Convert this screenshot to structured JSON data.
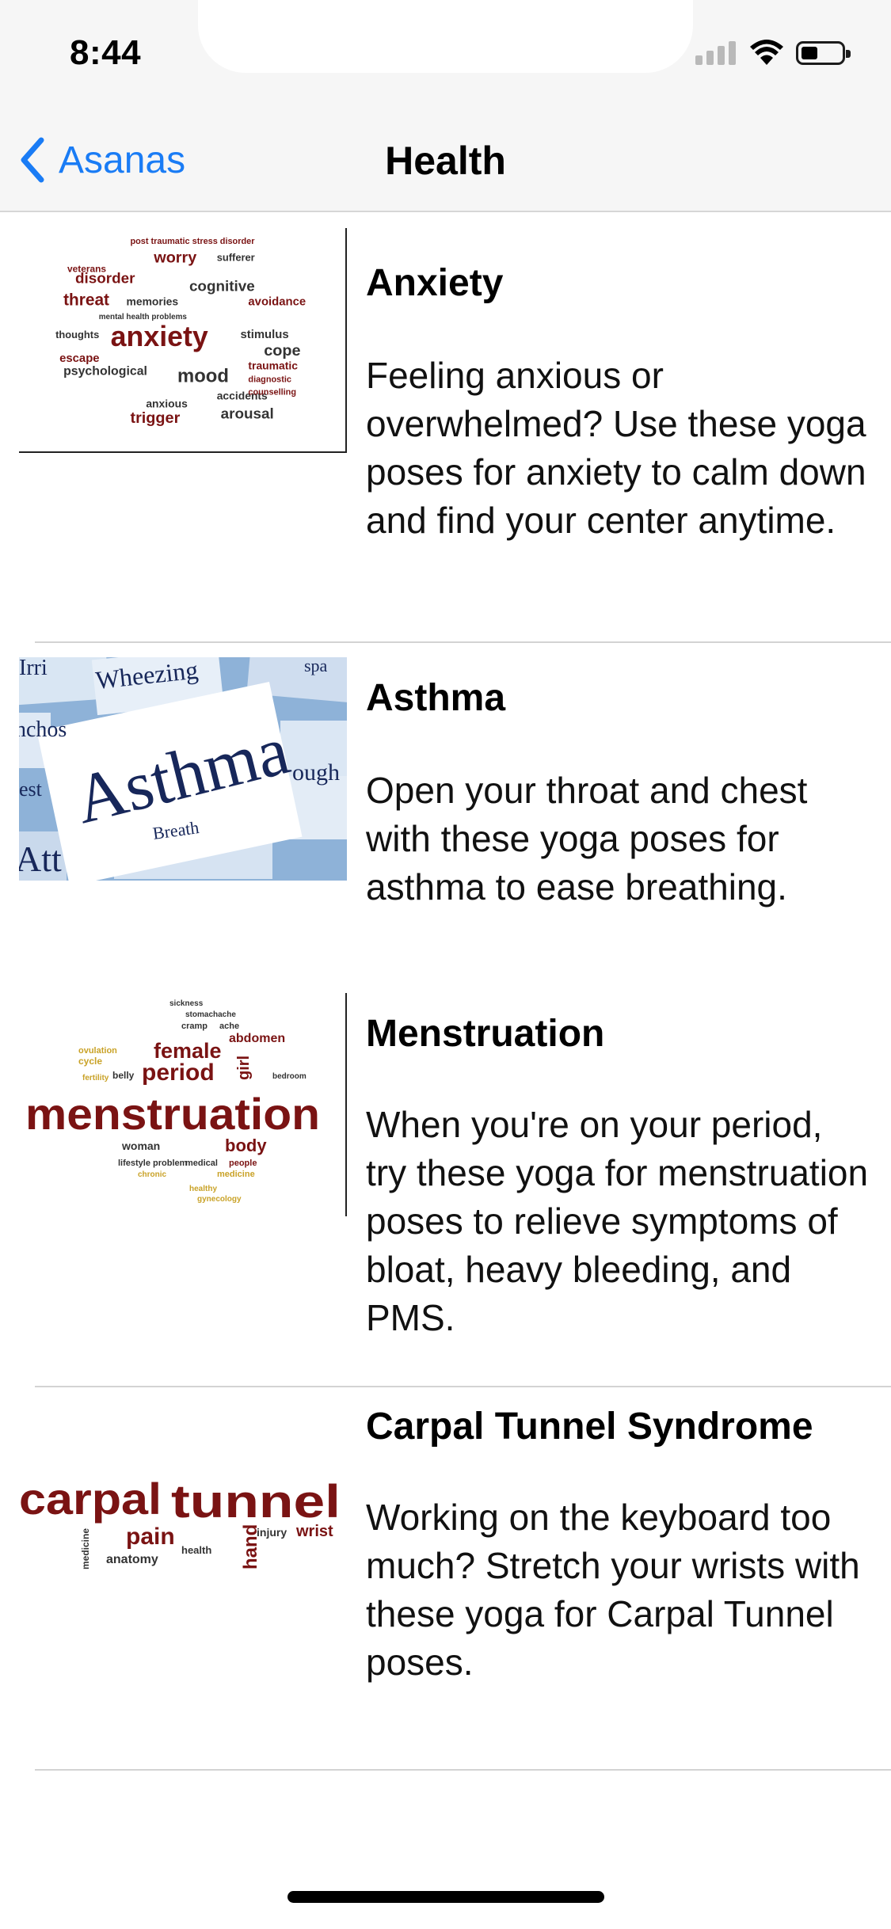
{
  "status_bar": {
    "time": "8:44"
  },
  "nav": {
    "back_label": "Asanas",
    "title": "Health"
  },
  "items": [
    {
      "title": "Anxiety",
      "description": "Feeling anxious or overwhelmed? Use these yoga poses for anxiety to calm down and find your center anytime.",
      "thumbnail": {
        "main_word": "anxiety",
        "words": [
          "post traumatic stress disorder",
          "worry",
          "sufferer",
          "disorder",
          "cognitive",
          "threat",
          "memories",
          "avoidance",
          "stimulus",
          "cope",
          "escape",
          "psychological",
          "mood",
          "traumatic",
          "diagnostic",
          "accidents",
          "counselling",
          "anxious",
          "trigger",
          "arousal",
          "thoughts",
          "veterans",
          "mental health problems"
        ]
      }
    },
    {
      "title": "Asthma",
      "description": "Open your throat and chest with these yoga poses for asthma to ease breathing.",
      "thumbnail": {
        "main_word": "Asthma",
        "words": [
          "Wheezing",
          "Irri",
          "nchos",
          "Breath",
          "ough",
          "spa",
          "est",
          "Att"
        ]
      }
    },
    {
      "title": "Menstruation",
      "description": "When you're on your period, try these yoga for menstruation poses to relieve symptoms of bloat, heavy bleeding, and PMS.",
      "thumbnail": {
        "main_word": "menstruation",
        "words": [
          "female",
          "period",
          "abdomen",
          "girl",
          "woman",
          "body",
          "cycle",
          "ovulation",
          "fertility",
          "belly",
          "lifestyle problem",
          "medical",
          "people",
          "chronic",
          "medicine",
          "healthy",
          "gynecology",
          "sickness",
          "stomachache",
          "cramp",
          "ache",
          "bedroom"
        ]
      }
    },
    {
      "title": "Carpal Tunnel Syndrome",
      "description": "Working on the keyboard too much? Stretch your wrists with these yoga for Carpal Tunnel poses.",
      "thumbnail": {
        "main_word_1": "carpal",
        "main_word_2": "tunnel",
        "words": [
          "pain",
          "wrist",
          "hand",
          "injury",
          "anatomy",
          "medicine",
          "health"
        ]
      }
    }
  ],
  "colors": {
    "accent": "#1a7cf5",
    "wordcloud_red": "#7a1313",
    "wordcloud_gold": "#c9a227",
    "asthma_blue": "#8eb2d8",
    "asthma_navy": "#17275a"
  }
}
